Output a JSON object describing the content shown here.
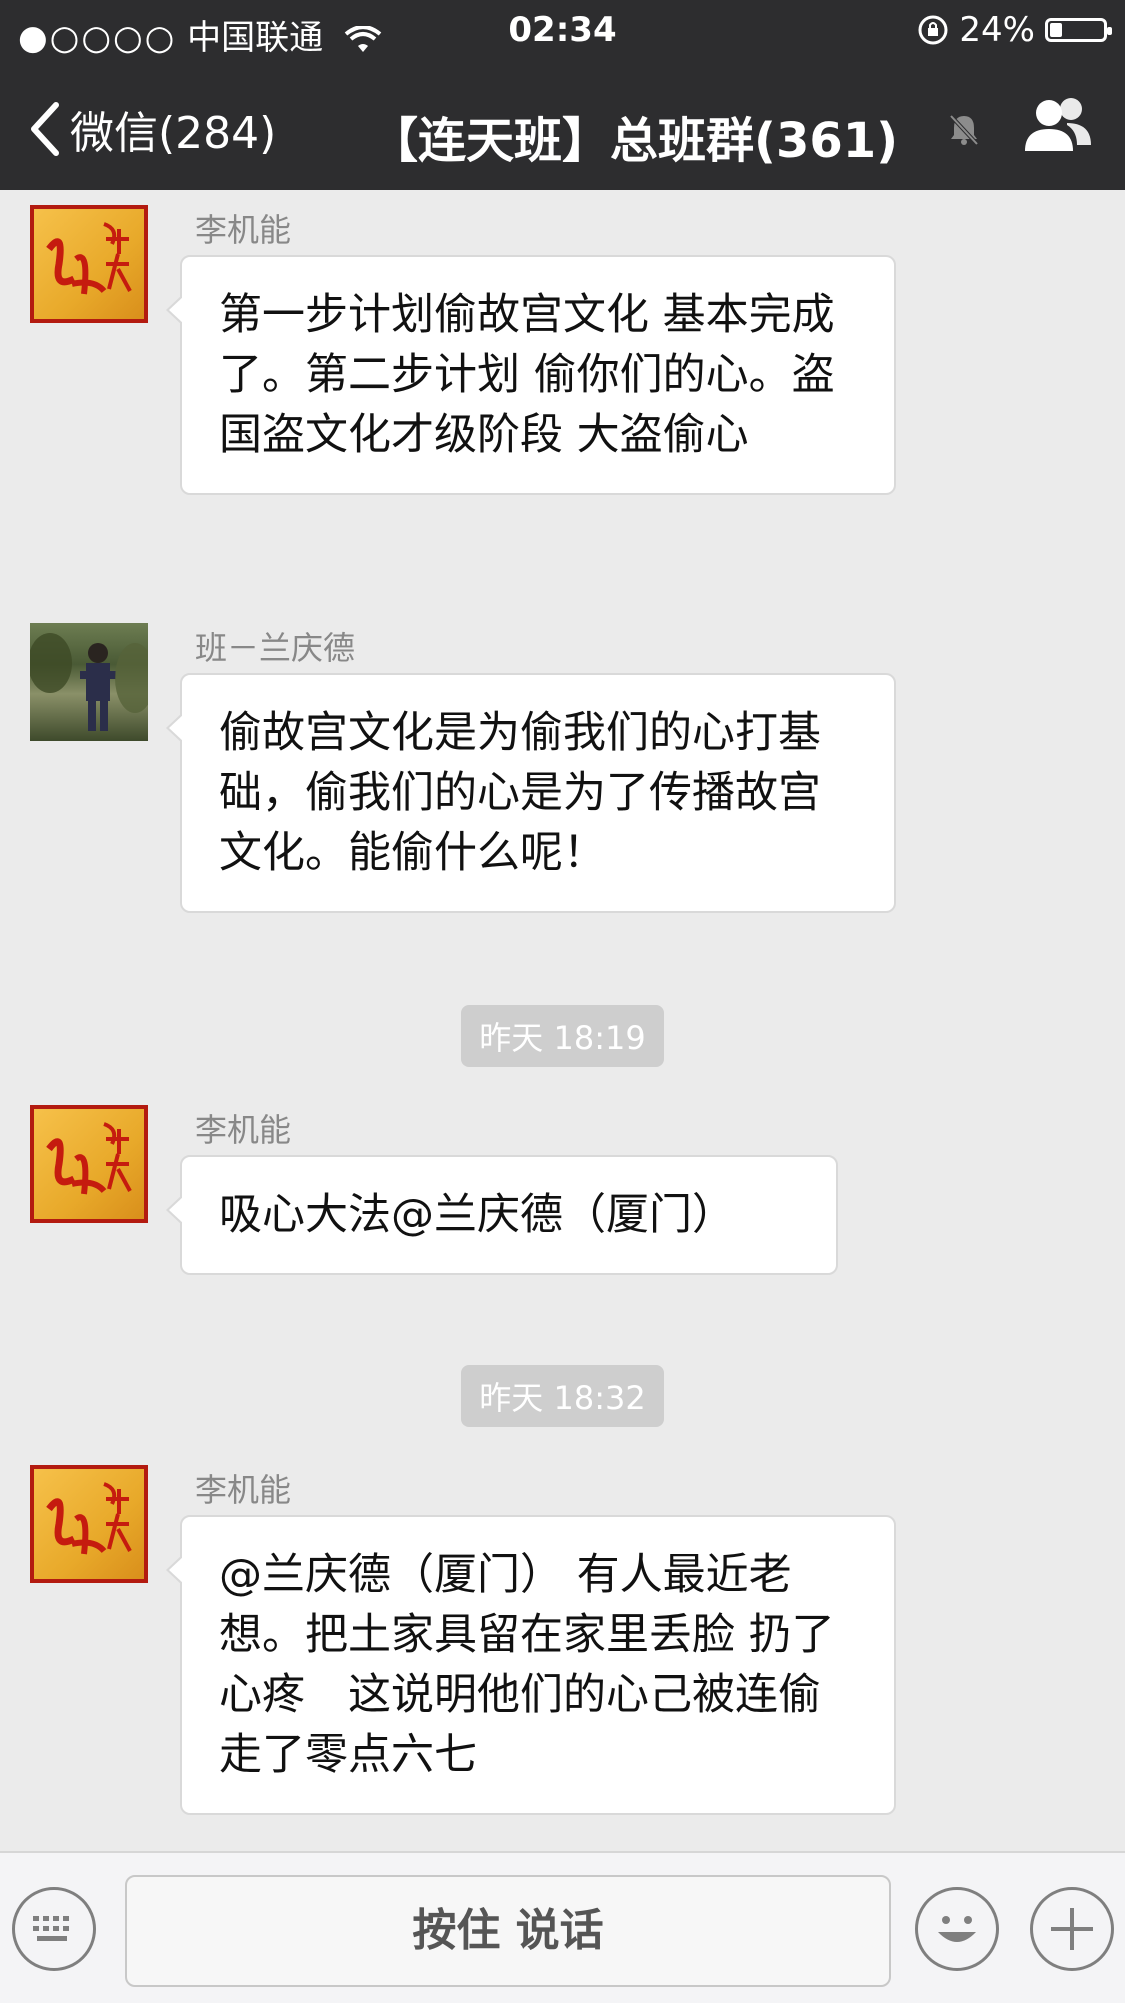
{
  "status_bar": {
    "signal": "●○○○○",
    "carrier": "中国联通",
    "time": "02:34",
    "battery_percent": "24%",
    "battery_level": 0.24
  },
  "nav": {
    "back_label": "微信(284)",
    "title": "【连天班】总班群(361)"
  },
  "messages": [
    {
      "sender": "李机能",
      "avatar": "red-calligraphy-avatar",
      "text": "第一步计划偷故宫文化 基本完成了。第二步计划 偷你们的心。盗国盗文化才级阶段 大盗偷心"
    },
    {
      "sender": "班－兰庆德",
      "avatar": "photo-avatar",
      "text": "偷故宫文化是为偷我们的心打基础，偷我们的心是为了传播故宫文化。能偷什么呢！"
    },
    {
      "timestamp": "昨天 18:19"
    },
    {
      "sender": "李机能",
      "avatar": "red-calligraphy-avatar",
      "text": "吸心大法@兰庆德（厦门）"
    },
    {
      "timestamp": "昨天 18:32"
    },
    {
      "sender": "李机能",
      "avatar": "red-calligraphy-avatar",
      "text": "@兰庆德（厦门） 有人最近老想。把土家具留在家里丢脸 扔了心疼　这说明他们的心己被连偷走了零点六七"
    }
  ],
  "input_bar": {
    "hold_to_talk": "按住 说话",
    "keyboard_icon": "keyboard-icon",
    "emoji_icon": "emoji-icon",
    "plus_icon": "plus-icon"
  },
  "colors": {
    "top_bar": "#2d2d2f",
    "chat_bg": "#ebebeb",
    "bubble_bg": "#ffffff",
    "timestamp_bg": "#cecece",
    "avatar_red": "#b31b10"
  }
}
